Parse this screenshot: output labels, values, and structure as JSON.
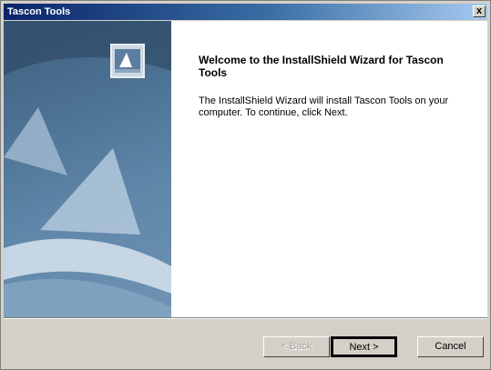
{
  "window": {
    "title": "Tascon Tools",
    "close_glyph": "x"
  },
  "wizard": {
    "heading": "Welcome to the InstallShield Wizard for Tascon Tools",
    "body": "The InstallShield Wizard will install Tascon Tools on your computer. To continue, click Next."
  },
  "buttons": {
    "back": "< Back",
    "next": "Next >",
    "cancel": "Cancel"
  },
  "colors": {
    "titlebar": "#0a246a",
    "side_panel": "#4e7496",
    "dialog_face": "#d4d0c8"
  }
}
